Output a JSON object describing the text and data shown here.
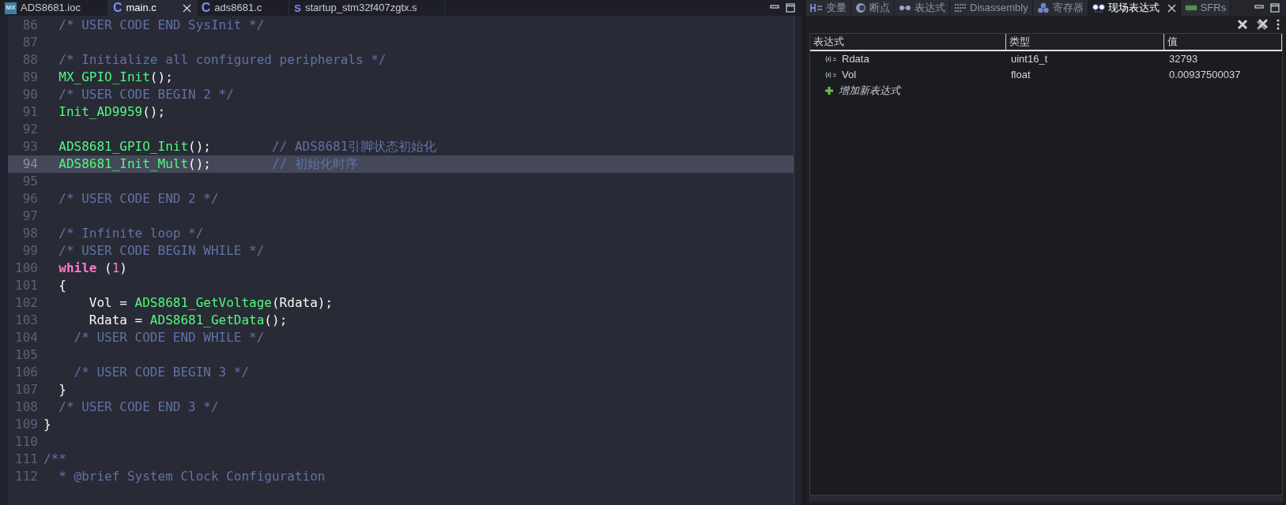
{
  "editor": {
    "tabs": [
      {
        "label": "ADS8681.ioc",
        "kind": "cubemx",
        "icon_text": "MX",
        "selected": false,
        "closable": false
      },
      {
        "label": "main.c",
        "kind": "c_source",
        "icon_text": "C",
        "selected": true,
        "closable": true
      },
      {
        "label": "ads8681.c",
        "kind": "c_source",
        "icon_text": "C",
        "selected": false,
        "closable": false
      },
      {
        "label": "startup_stm32f407zgtx.s",
        "kind": "assembly",
        "icon_text": "S",
        "selected": false,
        "closable": false
      }
    ],
    "lines": [
      {
        "number": "86",
        "highlighted": false,
        "tokens": [
          {
            "kind": "comment",
            "text": "  /* USER CODE END SysInit */"
          }
        ]
      },
      {
        "number": "87",
        "highlighted": false
      },
      {
        "number": "88",
        "highlighted": false,
        "tokens": [
          {
            "kind": "comment",
            "text": "  /* Initialize all configured peripherals */"
          }
        ]
      },
      {
        "number": "89",
        "highlighted": false,
        "tokens": [
          {
            "kind": "func",
            "text": "  MX_GPIO_Init"
          },
          {
            "kind": "punct",
            "text": "();"
          }
        ]
      },
      {
        "number": "90",
        "highlighted": false,
        "tokens": [
          {
            "kind": "comment",
            "text": "  /* USER CODE BEGIN 2 */"
          }
        ]
      },
      {
        "number": "91",
        "highlighted": false,
        "tokens": [
          {
            "kind": "func",
            "text": "  Init_AD9959"
          },
          {
            "kind": "punct",
            "text": "();"
          }
        ]
      },
      {
        "number": "92",
        "highlighted": false
      },
      {
        "number": "93",
        "highlighted": false,
        "tokens": [
          {
            "kind": "func",
            "text": "  ADS8681_GPIO_Init"
          },
          {
            "kind": "punct",
            "text": "();"
          },
          {
            "kind": "trailing_comment",
            "text": "// ADS8681引脚状态初始化"
          }
        ]
      },
      {
        "number": "94",
        "highlighted": true,
        "tokens": [
          {
            "kind": "func",
            "text": "  ADS8681_Init_Mult"
          },
          {
            "kind": "punct",
            "text": "();"
          },
          {
            "kind": "trailing_comment",
            "text": "// 初始化时序"
          }
        ]
      },
      {
        "number": "95",
        "highlighted": false
      },
      {
        "number": "96",
        "highlighted": false,
        "tokens": [
          {
            "kind": "comment",
            "text": "  /* USER CODE END 2 */"
          }
        ]
      },
      {
        "number": "97",
        "highlighted": false
      },
      {
        "number": "98",
        "highlighted": false,
        "tokens": [
          {
            "kind": "comment",
            "text": "  /* Infinite loop */"
          }
        ]
      },
      {
        "number": "99",
        "highlighted": false,
        "tokens": [
          {
            "kind": "comment",
            "text": "  /* USER CODE BEGIN WHILE */"
          }
        ]
      },
      {
        "number": "100",
        "highlighted": false,
        "tokens": [
          {
            "kind": "keyword",
            "text": "  while"
          },
          {
            "kind": "plain",
            "text": " ("
          },
          {
            "kind": "number",
            "text": "1"
          },
          {
            "kind": "plain",
            "text": ")"
          }
        ]
      },
      {
        "number": "101",
        "highlighted": false,
        "tokens": [
          {
            "kind": "plain",
            "text": "  {"
          }
        ]
      },
      {
        "number": "102",
        "highlighted": false,
        "tokens": [
          {
            "kind": "plain",
            "text": "      Vol = "
          },
          {
            "kind": "func",
            "text": "ADS8681_GetVoltage"
          },
          {
            "kind": "plain",
            "text": "(Rdata);"
          }
        ]
      },
      {
        "number": "103",
        "highlighted": false,
        "tokens": [
          {
            "kind": "plain",
            "text": "      Rdata = "
          },
          {
            "kind": "func",
            "text": "ADS8681_GetData"
          },
          {
            "kind": "punct",
            "text": "();"
          }
        ]
      },
      {
        "number": "104",
        "highlighted": false,
        "tokens": [
          {
            "kind": "comment",
            "text": "    /* USER CODE END WHILE */"
          }
        ]
      },
      {
        "number": "105",
        "highlighted": false
      },
      {
        "number": "106",
        "highlighted": false,
        "tokens": [
          {
            "kind": "comment",
            "text": "    /* USER CODE BEGIN 3 */"
          }
        ]
      },
      {
        "number": "107",
        "highlighted": false,
        "tokens": [
          {
            "kind": "plain",
            "text": "  }"
          }
        ]
      },
      {
        "number": "108",
        "highlighted": false,
        "tokens": [
          {
            "kind": "comment",
            "text": "  /* USER CODE END 3 */"
          }
        ]
      },
      {
        "number": "109",
        "highlighted": false,
        "tokens": [
          {
            "kind": "plain",
            "text": "}"
          }
        ]
      },
      {
        "number": "110",
        "highlighted": false
      },
      {
        "number": "111",
        "highlighted": false,
        "tokens": [
          {
            "kind": "comment",
            "text": "/**"
          }
        ]
      },
      {
        "number": "112",
        "highlighted": false,
        "tokens": [
          {
            "kind": "comment",
            "text": "  * @brief System Clock Configuration"
          }
        ]
      }
    ]
  },
  "panel": {
    "tabs": [
      {
        "label": "变量",
        "kind": "variables",
        "selected": false,
        "closable": false
      },
      {
        "label": "断点",
        "kind": "breakpoints",
        "selected": false,
        "closable": false
      },
      {
        "label": "表达式",
        "kind": "expressions",
        "selected": false,
        "closable": false
      },
      {
        "label": "Disassembly",
        "kind": "disassembly",
        "selected": false,
        "closable": false
      },
      {
        "label": "寄存器",
        "kind": "registers",
        "selected": false,
        "closable": false
      },
      {
        "label": "现场表达式",
        "kind": "live",
        "selected": true,
        "closable": true
      },
      {
        "label": "SFRs",
        "kind": "sfr",
        "selected": false,
        "closable": false
      }
    ],
    "table": {
      "columns": [
        "表达式",
        "类型",
        "值"
      ],
      "rows": [
        {
          "expression": "Rdata",
          "type": "uint16_t",
          "value": "32793"
        },
        {
          "expression": "Vol",
          "type": "float",
          "value": "0.00937500037"
        }
      ],
      "add_row": "增加新表达式"
    }
  }
}
